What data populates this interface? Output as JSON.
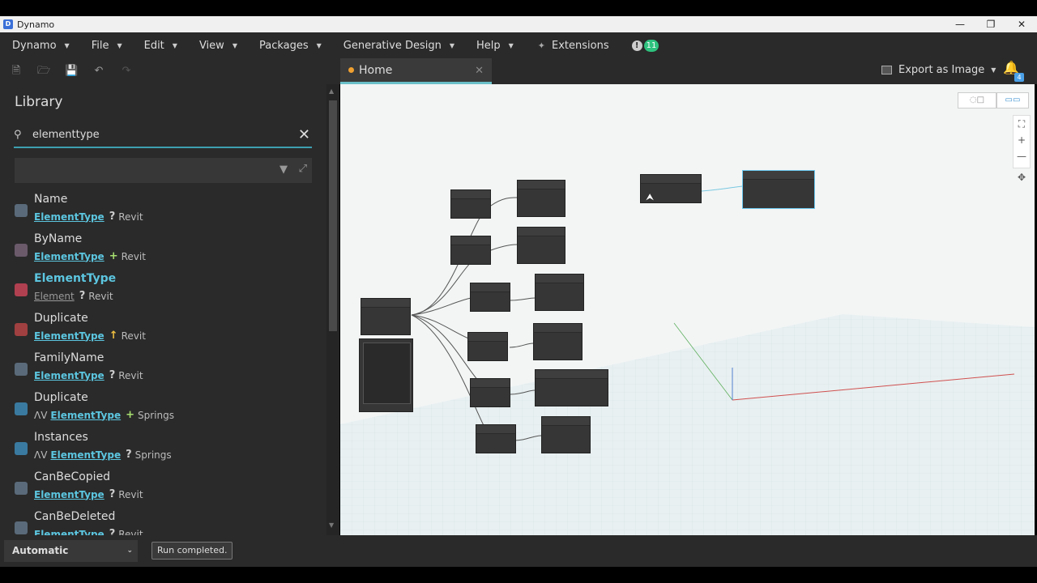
{
  "window": {
    "title": "Dynamo",
    "icon": "dynamo-logo-icon"
  },
  "menu": {
    "items": [
      {
        "label": "Dynamo"
      },
      {
        "label": "File"
      },
      {
        "label": "Edit"
      },
      {
        "label": "View"
      },
      {
        "label": "Packages"
      },
      {
        "label": "Generative Design"
      },
      {
        "label": "Help"
      }
    ],
    "extensions": "Extensions",
    "notification_count": "11"
  },
  "tab": {
    "label": "Home"
  },
  "export": {
    "label": "Export as Image"
  },
  "bell_count": "4",
  "library": {
    "title": "Library",
    "search_value": "elementtype",
    "results": [
      {
        "name": "Name",
        "category": "ElementType",
        "type": "?",
        "lib": "Revit",
        "icon": "query-node-icon"
      },
      {
        "name": "ByName",
        "category": "ElementType",
        "type": "+",
        "lib": "Revit",
        "icon": "create-node-icon"
      },
      {
        "name": "ElementType",
        "category": "Element",
        "type": "?",
        "lib": "Revit",
        "icon": "revit-element-icon"
      },
      {
        "name": "Duplicate",
        "category": "ElementType",
        "type": "↑",
        "lib": "Revit",
        "icon": "action-node-icon"
      },
      {
        "name": "FamilyName",
        "category": "ElementType",
        "type": "?",
        "lib": "Revit",
        "icon": "query-node-icon"
      },
      {
        "name": "Duplicate",
        "category": "ElementType",
        "type": "+",
        "lib": "Springs",
        "icon": "springs-node-icon",
        "prefix": "ΛV"
      },
      {
        "name": "Instances",
        "category": "ElementType",
        "type": "?",
        "lib": "Springs",
        "icon": "springs-node-icon",
        "prefix": "ΛV"
      },
      {
        "name": "CanBeCopied",
        "category": "ElementType",
        "type": "?",
        "lib": "Revit",
        "icon": "query-node-icon"
      },
      {
        "name": "CanBeDeleted",
        "category": "ElementType",
        "type": "?",
        "lib": "Revit",
        "icon": "query-node-icon"
      }
    ]
  },
  "status": {
    "run_mode": "Automatic",
    "run_message": "Run completed."
  },
  "colors": {
    "accent": "#5cc6e0",
    "tab_indicator": "#f0a030",
    "badge": "#2ec27e"
  }
}
